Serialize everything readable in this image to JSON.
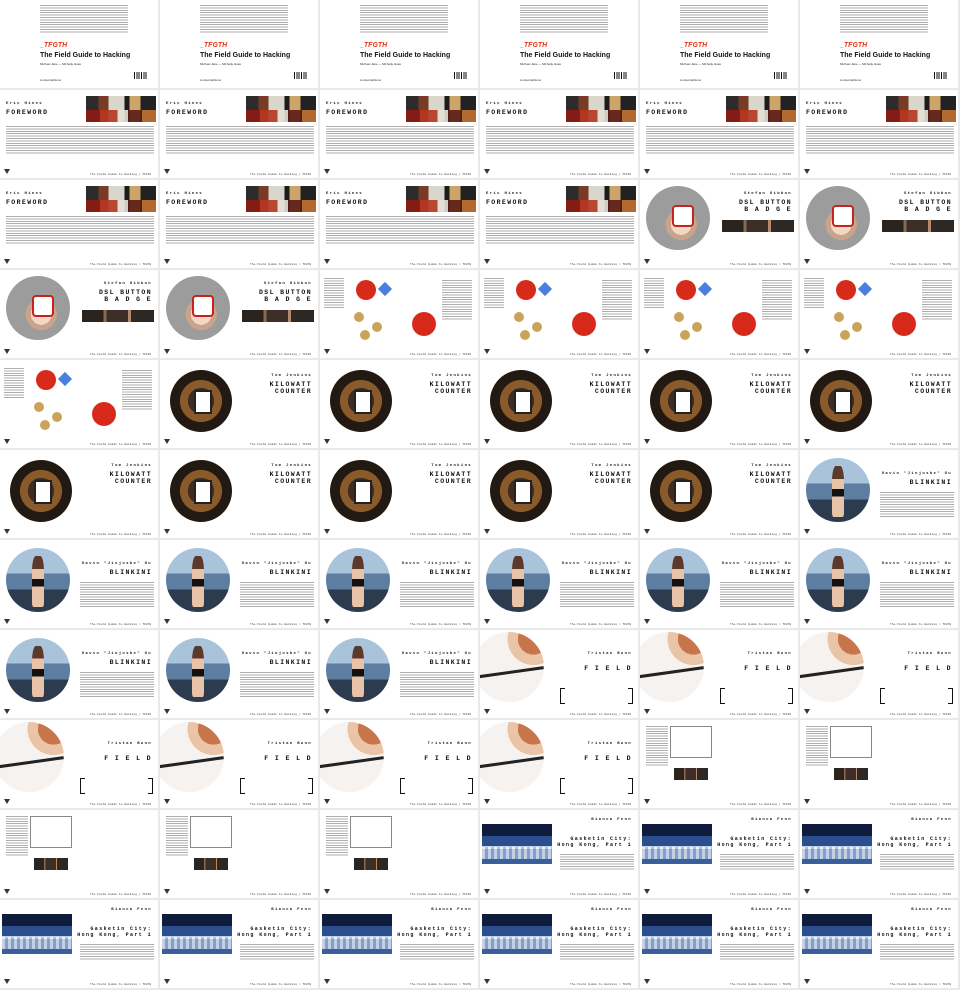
{
  "cover": {
    "tag": "_TFGTH",
    "title": "The Field Guide to Hacking",
    "subtitle": "Michael Jake — Michelle Haas",
    "publisher": "Limited Editions"
  },
  "footer_label": "The Field Guide to Hacking  |  TFGTH",
  "chapters": {
    "foreword": {
      "author": "Eric Hines",
      "title": "FOREWORD"
    },
    "badge": {
      "author": "Stefan Gibbon",
      "title": "DSL BUTTON\nB A D G E"
    },
    "kilowatt": {
      "author": "Tom Jenkins",
      "title": "KILOWATT\nCOUNTER"
    },
    "blinkini": {
      "author": "Gavin \"Jinjosbe\" Gu",
      "title": "BLINKINI"
    },
    "field": {
      "author": "Tristan Bunn",
      "title": "F I E L D"
    },
    "city": {
      "author": "Bianca Fenn",
      "title": "Gasketin City:\nHong Kong, Part 1"
    }
  },
  "pages": [
    "cover",
    "cover",
    "cover",
    "cover",
    "cover",
    "cover",
    "foreword",
    "foreword",
    "foreword",
    "foreword",
    "foreword",
    "foreword",
    "foreword",
    "foreword",
    "foreword",
    "foreword",
    "badge",
    "badge",
    "badge",
    "badge",
    "parts",
    "parts",
    "parts",
    "parts",
    "parts",
    "kilowatt",
    "kilowatt",
    "kilowatt",
    "kilowatt",
    "kilowatt",
    "kilowatt",
    "kilowatt",
    "kilowatt",
    "kilowatt",
    "kilowatt",
    "blinkini",
    "blinkini",
    "blinkini",
    "blinkini",
    "blinkini",
    "blinkini",
    "blinkini",
    "blinkini",
    "blinkini",
    "blinkini",
    "field",
    "field",
    "field",
    "field",
    "field",
    "field",
    "field",
    "schem",
    "schem",
    "schem",
    "schem",
    "schem",
    "city",
    "city",
    "city",
    "city",
    "city",
    "city",
    "city",
    "city",
    "city"
  ]
}
